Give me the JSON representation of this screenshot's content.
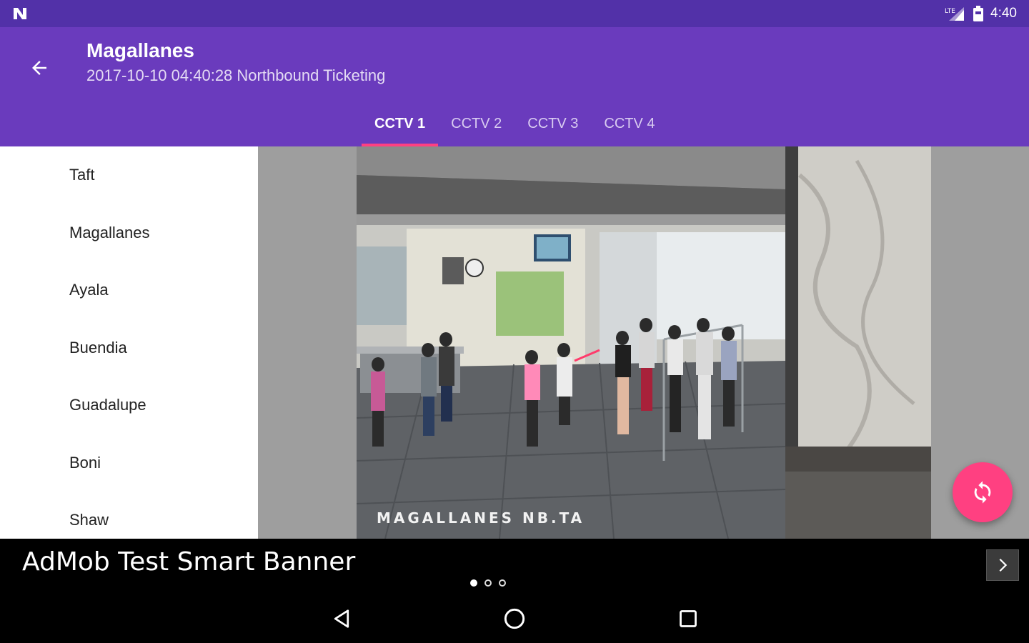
{
  "status_bar": {
    "time": "4:40",
    "icons": [
      "n-logo-icon",
      "signal-icon",
      "battery-icon"
    ]
  },
  "app_bar": {
    "title": "Magallanes",
    "subtitle": "2017-10-10 04:40:28 Northbound Ticketing"
  },
  "tabs": [
    {
      "label": "CCTV 1",
      "active": true
    },
    {
      "label": "CCTV 2",
      "active": false
    },
    {
      "label": "CCTV 3",
      "active": false
    },
    {
      "label": "CCTV 4",
      "active": false
    }
  ],
  "stations": [
    {
      "label": "Taft"
    },
    {
      "label": "Magallanes"
    },
    {
      "label": "Ayala"
    },
    {
      "label": "Buendia"
    },
    {
      "label": "Guadalupe"
    },
    {
      "label": "Boni"
    },
    {
      "label": "Shaw"
    }
  ],
  "camera": {
    "overlay_text": "MAGALLANES NB.TA"
  },
  "ad": {
    "text": "AdMob Test Smart Banner",
    "dots": 3,
    "active_dot": 0
  },
  "colors": {
    "status_bar": "#5231a8",
    "app_bar": "#6a3bbd",
    "accent": "#ff4081",
    "list_bg": "#ffffff",
    "viewer_bg": "#9e9e9e"
  }
}
